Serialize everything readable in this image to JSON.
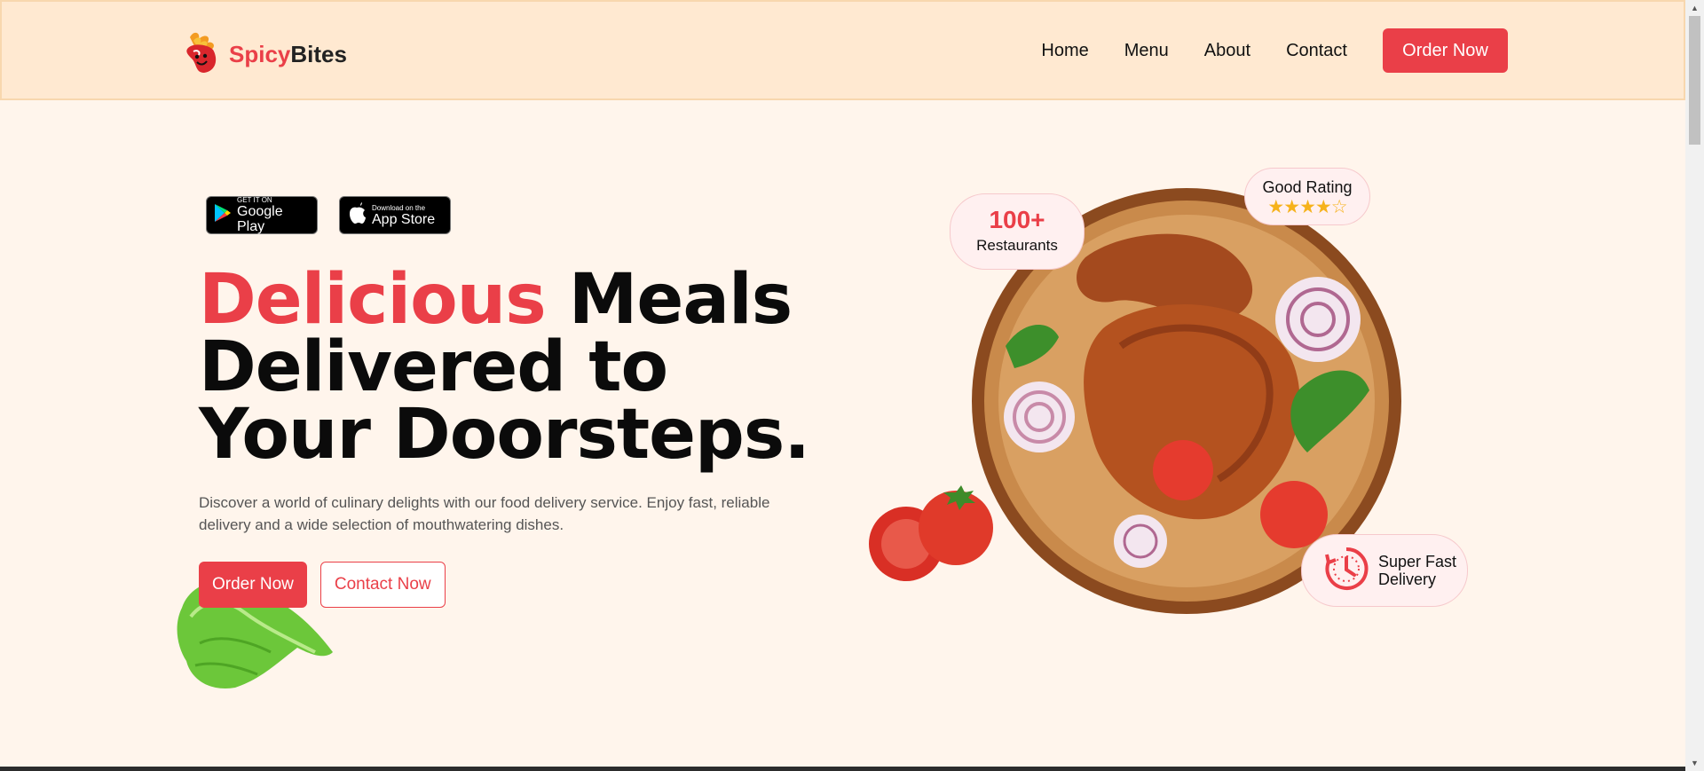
{
  "brand": {
    "part1": "Spicy",
    "part2": "Bites"
  },
  "nav": {
    "items": [
      "Home",
      "Menu",
      "About",
      "Contact"
    ],
    "order_button": "Order Now"
  },
  "app_badges": {
    "google_play": {
      "small": "GET IT ON",
      "big": "Google Play"
    },
    "app_store": {
      "small": "Download on the",
      "big": "App Store"
    }
  },
  "hero": {
    "title_highlight": "Delicious",
    "title_rest": " Meals Delivered to Your Doorsteps.",
    "description": "Discover a world of culinary delights with our food delivery service. Enjoy fast, reliable delivery and a wide selection of mouthwatering dishes.",
    "order_button": "Order Now",
    "contact_button": "Contact Now"
  },
  "stats": {
    "restaurants_count": "100+",
    "restaurants_label": "Restaurants",
    "rating_label": "Good Rating",
    "rating_stars": "★★★★☆",
    "rating_value": 4,
    "rating_max": 5,
    "delivery_label": "Super Fast Delivery"
  },
  "colors": {
    "accent": "#ea3f48",
    "header_bg": "#ffe9d1",
    "page_bg": "#fff5ec",
    "star": "#f6b21b"
  },
  "icons": [
    "chili-logo-icon",
    "google-play-icon",
    "apple-icon",
    "clock-icon"
  ]
}
